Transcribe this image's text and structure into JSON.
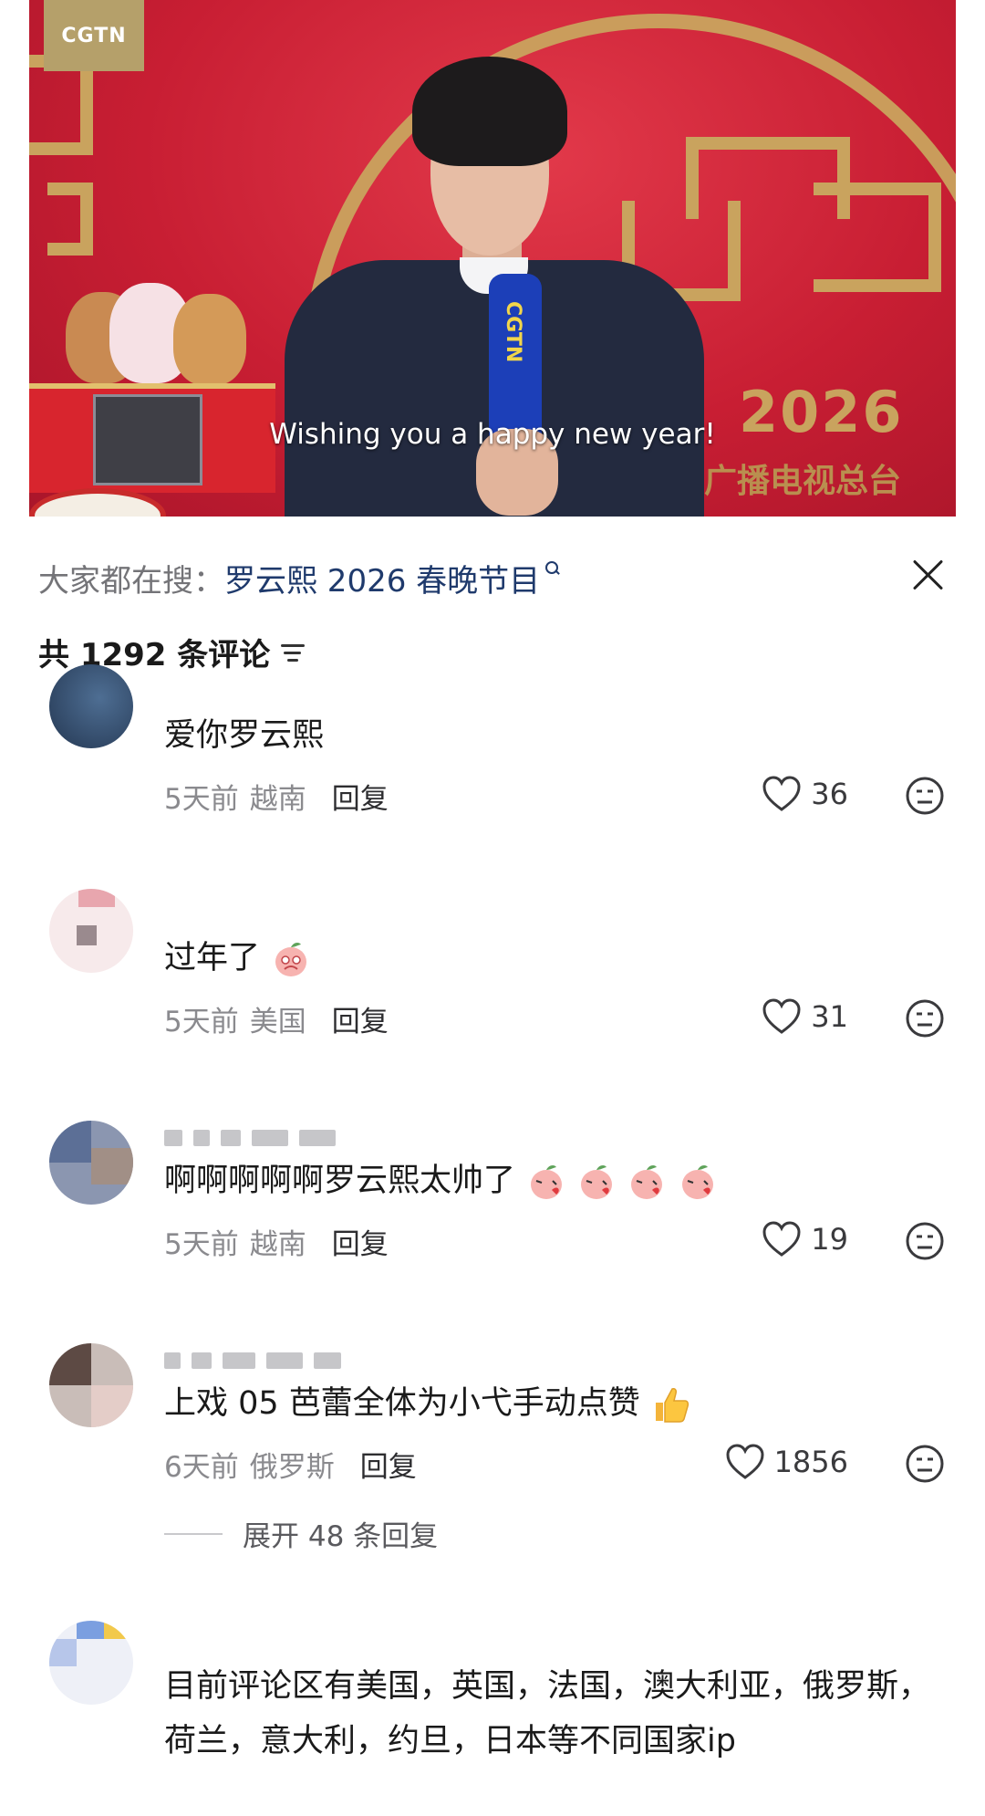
{
  "video": {
    "channel_logo": "CGTN",
    "mic_label": "CGTN",
    "backdrop_year": "2026",
    "backdrop_text": "广播电视总台",
    "caption": "Wishing you a happy new year!"
  },
  "panel": {
    "search_prefix": "大家都在搜：",
    "search_term": "罗云熙 2026 春晚节目",
    "comment_count_label": "共 1292 条评论",
    "icons": {
      "search": "search-icon",
      "close": "close-icon",
      "sort": "sort-icon",
      "like": "heart-icon",
      "dislike": "dislike-face-icon"
    },
    "accent_color": "#1f3a6c"
  },
  "comments": [
    {
      "text": "爱你罗云熙",
      "time": "5天前",
      "location": "越南",
      "reply_label": "回复",
      "likes": "36",
      "emojis": []
    },
    {
      "text": "过年了",
      "time": "5天前",
      "location": "美国",
      "reply_label": "回复",
      "likes": "31",
      "emojis": [
        "peach-face"
      ]
    },
    {
      "text": "啊啊啊啊啊罗云熙太帅了",
      "time": "5天前",
      "location": "越南",
      "reply_label": "回复",
      "likes": "19",
      "emojis": [
        "peach-kiss",
        "peach-kiss",
        "peach-kiss",
        "peach-kiss"
      ]
    },
    {
      "text": "上戏 05 芭蕾全体为小弋手动点赞",
      "time": "6天前",
      "location": "俄罗斯",
      "reply_label": "回复",
      "likes": "1856",
      "emojis": [
        "thumbs-up"
      ],
      "expand_label": "展开 48 条回复"
    },
    {
      "text": "目前评论区有美国，英国，法国，澳大利亚，俄罗斯，荷兰，意大利，约旦，日本等不同国家ip",
      "emojis": []
    }
  ]
}
